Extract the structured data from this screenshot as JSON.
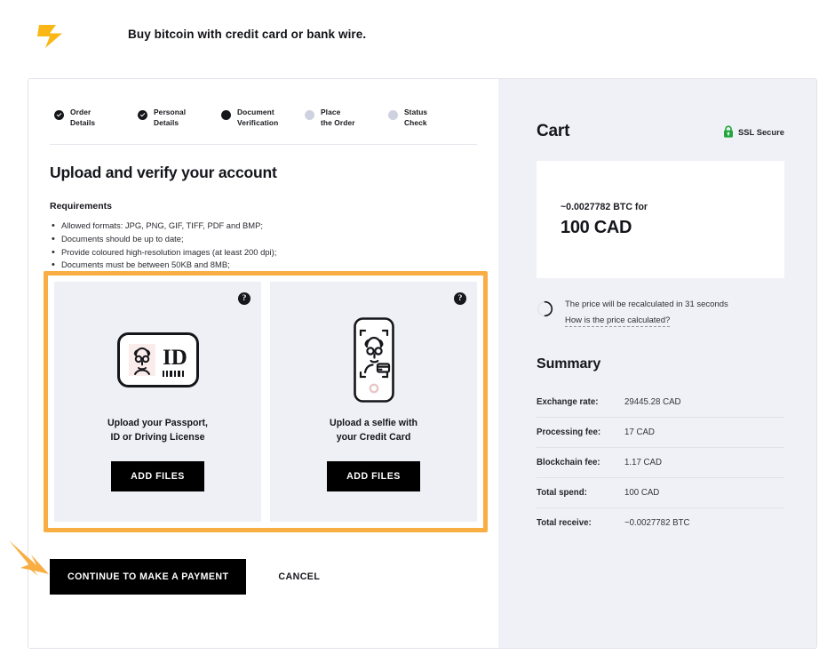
{
  "header": {
    "logo_icon": "lightning-bolt-logo",
    "tagline": "Buy bitcoin with credit\ncard or bank wire."
  },
  "stepper": {
    "steps": [
      {
        "label": "Order\nDetails",
        "state": "done"
      },
      {
        "label": "Personal\nDetails",
        "state": "done"
      },
      {
        "label": "Document\nVerification",
        "state": "active"
      },
      {
        "label": "Place\nthe Order",
        "state": "pending"
      },
      {
        "label": "Status\nCheck",
        "state": "pending"
      }
    ]
  },
  "main": {
    "title": "Upload and verify your account",
    "requirements_title": "Requirements",
    "requirements": [
      "Allowed formats: JPG, PNG, GIF, TIFF, PDF and BMP;",
      "Documents should be up to date;",
      "Provide coloured high-resolution images (at least 200 dpi);",
      "Documents must be between 50KB and 8MB;"
    ],
    "highlight_color": "#f9ae43",
    "upload_cards": [
      {
        "help_glyph": "?",
        "art_icon": "id-card-icon",
        "caption": "Upload your Passport,\nID or Driving License",
        "button_label": "ADD FILES"
      },
      {
        "help_glyph": "?",
        "art_icon": "selfie-with-card-icon",
        "caption": "Upload a selfie with\nyour Credit Card",
        "button_label": "ADD FILES"
      }
    ],
    "primary_button": "CONTINUE TO MAKE A PAYMENT",
    "cancel_button": "CANCEL",
    "annotation_arrow_color": "#f9ae43"
  },
  "cart": {
    "title": "Cart",
    "ssl_label": "SSL Secure",
    "ssl_icon": "green-padlock-icon",
    "ssl_color": "#21a73c",
    "amount_sub": "~0.0027782 BTC for",
    "amount_main": "100 CAD",
    "recalc_text": "The price will be recalculated in 31 seconds",
    "recalc_link": "How is the price calculated?",
    "spinner_icon": "circular-timer-icon",
    "summary_title": "Summary",
    "summary_rows": [
      {
        "label": "Exchange rate:",
        "value": "29445.28 CAD"
      },
      {
        "label": "Processing fee:",
        "value": "17 CAD"
      },
      {
        "label": "Blockchain fee:",
        "value": "1.17 CAD"
      },
      {
        "label": "Total spend:",
        "value": "100 CAD"
      },
      {
        "label": "Total receive:",
        "value": "~0.0027782 BTC"
      }
    ]
  }
}
